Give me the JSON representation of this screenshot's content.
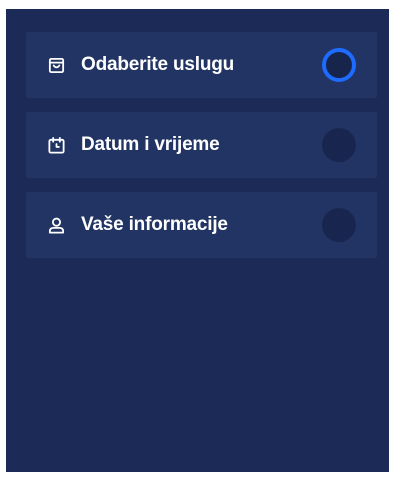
{
  "steps": [
    {
      "label": "Odaberite uslugu",
      "icon": "shopping-bag-icon",
      "state": "active"
    },
    {
      "label": "Datum i vrijeme",
      "icon": "calendar-icon",
      "state": "pending"
    },
    {
      "label": "Vaše informacije",
      "icon": "user-icon",
      "state": "pending"
    }
  ],
  "colors": {
    "sidebar_background": "#1b2a57",
    "step_background": "#223463",
    "active_ring": "#1e6bff",
    "pending_dot": "#18264f",
    "text": "#ffffff"
  }
}
